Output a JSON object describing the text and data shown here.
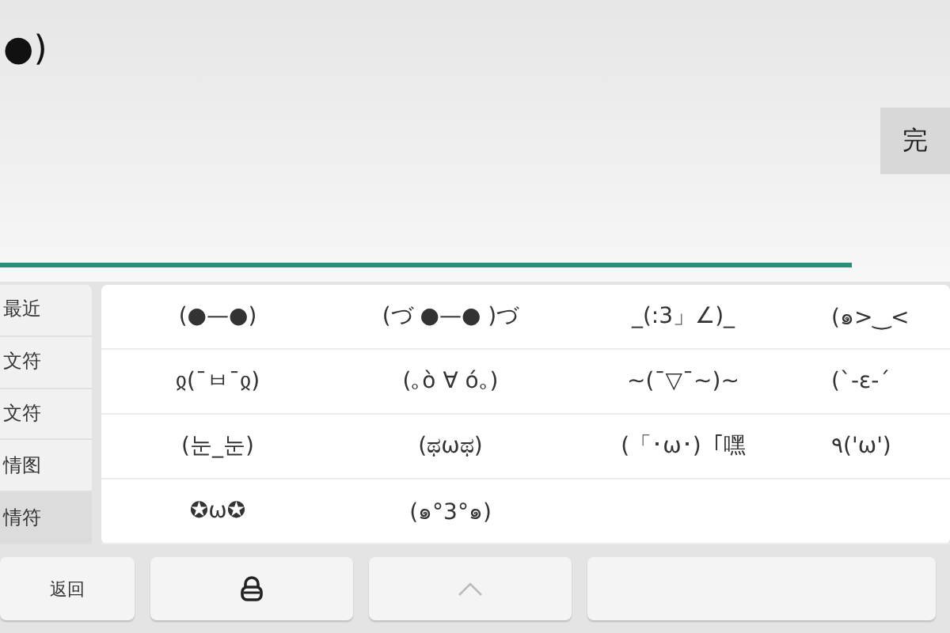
{
  "input": {
    "text": "●)"
  },
  "done_button": {
    "label": "完"
  },
  "categories": [
    {
      "label": "最近",
      "selected": false
    },
    {
      "label": "文符",
      "selected": false
    },
    {
      "label": "文符",
      "selected": false
    },
    {
      "label": "情图",
      "selected": false
    },
    {
      "label": "情符",
      "selected": true
    }
  ],
  "emoticons": [
    [
      "(●—●)",
      "(づ ●—● )づ",
      "_(:3」∠)_",
      "(๑>‿<"
    ],
    [
      "ჲ(¯ㅂ¯ჲ)",
      "(｡ò ∀ ó｡)",
      "~(¯▽¯~)~",
      "(`-ε-´"
    ],
    [
      "(눈_눈)",
      "(ಥωಥ)",
      "(「･ω･)「嘿",
      "٩('ω')"
    ],
    [
      "✪ω✪",
      "(๑°3°๑)"
    ]
  ],
  "keys": [
    {
      "kind": "text",
      "label": "返回"
    },
    {
      "kind": "lock"
    },
    {
      "kind": "caret"
    },
    {
      "kind": "blank"
    }
  ]
}
